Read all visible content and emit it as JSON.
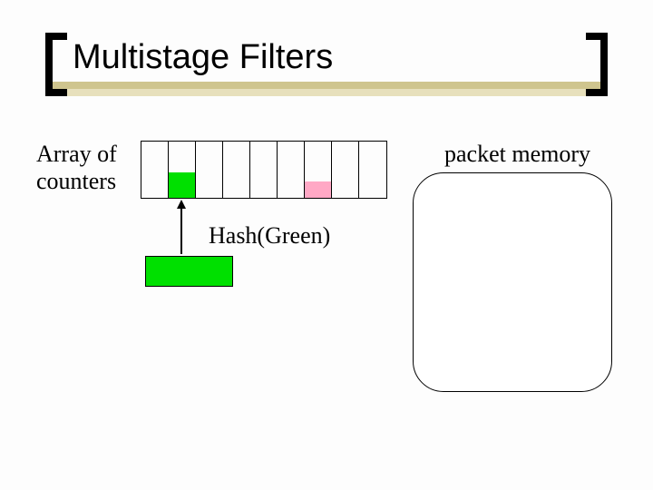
{
  "title": "Multistage Filters",
  "labels": {
    "array": "Array of counters",
    "packet_memory": "packet memory",
    "hash": "Hash(Green)"
  },
  "counters": {
    "num_cells": 9,
    "fills": [
      {
        "index": 1,
        "color": "green"
      },
      {
        "index": 6,
        "color": "pink"
      }
    ]
  },
  "arrow": {
    "from": "green-packet-box",
    "to_counter_index": 1
  },
  "colors": {
    "green": "#00e000",
    "pink": "#ffa8c5",
    "band_dark": "#cfc58e",
    "band_light": "#e7e0bc"
  }
}
